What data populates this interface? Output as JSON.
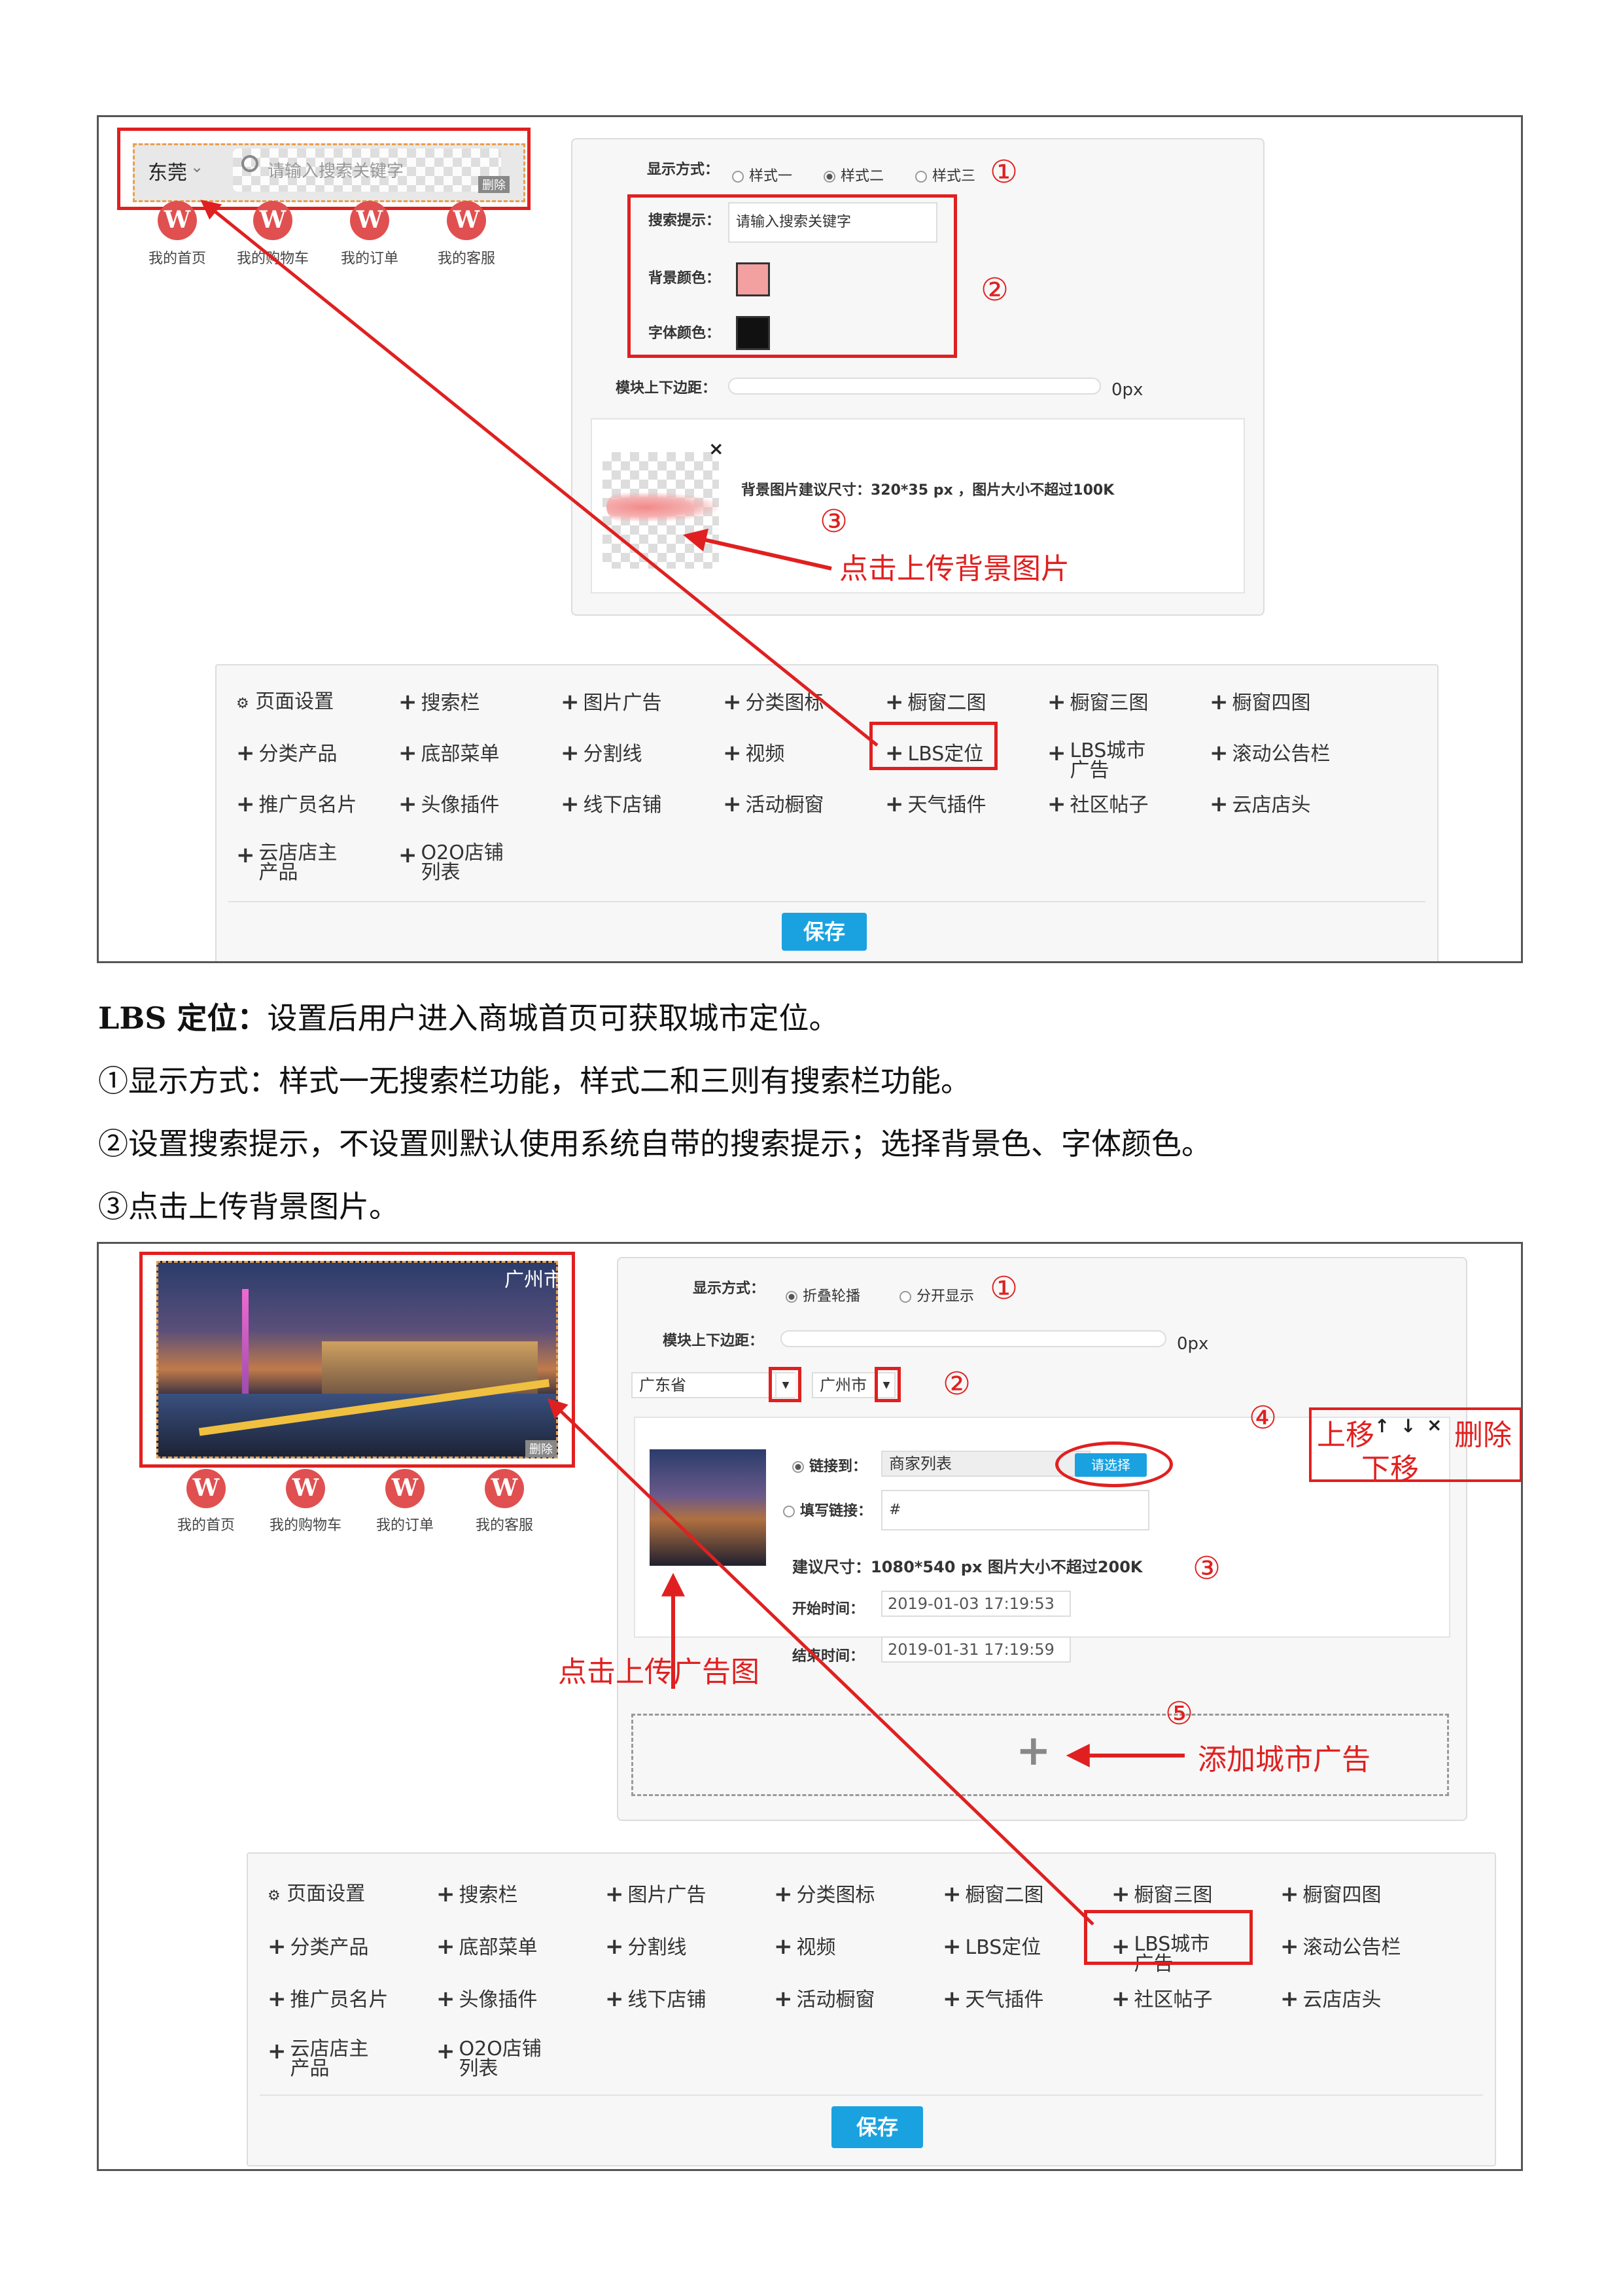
{
  "shot1": {
    "nav": {
      "city": "东莞",
      "search_placeholder": "请输入搜索关键字",
      "delete_label": "删除",
      "items": [
        "我的首页",
        "我的购物车",
        "我的订单",
        "我的客服"
      ]
    },
    "settings": {
      "display_label": "显示方式：",
      "styles": [
        "样式一",
        "样式二",
        "样式三"
      ],
      "search_hint_label": "搜索提示：",
      "search_hint_value": "请输入搜索关键字",
      "bg_color_label": "背景颜色：",
      "font_color_label": "字体颜色：",
      "margin_label": "模块上下边距：",
      "margin_value": "0px",
      "bg_image_hint": "背景图片建议尺寸：320*35 px ，图片大小不超过100K",
      "remove_glyph": "×"
    },
    "annotations": {
      "n1": "①",
      "n2": "②",
      "n3": "③",
      "upload_bg": "点击上传背景图片"
    }
  },
  "component_grid": {
    "page_settings": "页面设置",
    "items": [
      "搜索栏",
      "图片广告",
      "分类图标",
      "橱窗二图",
      "橱窗三图",
      "橱窗四图",
      "分类产品",
      "底部菜单",
      "分割线",
      "视频",
      "LBS定位",
      "LBS城市广告",
      "滚动公告栏",
      "推广员名片",
      "头像插件",
      "线下店铺",
      "活动橱窗",
      "天气插件",
      "社区帖子",
      "云店店头",
      "云店店主产品",
      "O2O店铺列表"
    ],
    "save": "保存"
  },
  "text": {
    "p1_title": "LBS 定位：",
    "p1_body": "设置后用户进入商城首页可获取城市定位。",
    "p2": "①显示方式：样式一无搜索栏功能，样式二和三则有搜索栏功能。",
    "p3": "②设置搜索提示，不设置则默认使用系统自带的搜索提示；选择背景色、字体颜色。",
    "p4": "③点击上传背景图片。"
  },
  "shot2": {
    "banner_city": "广州市",
    "delete_label": "删除",
    "nav_items": [
      "我的首页",
      "我的购物车",
      "我的订单",
      "我的客服"
    ],
    "settings": {
      "display_label": "显示方式：",
      "modes": [
        "折叠轮播",
        "分开显示"
      ],
      "margin_label": "模块上下边距：",
      "margin_value": "0px",
      "province": "广东省",
      "city": "广州市",
      "link_to_label": "链接到：",
      "link_to_value": "商家列表",
      "choose_button": "请选择",
      "fill_link_label": "填写链接：",
      "fill_link_value": "#",
      "size_hint": "建议尺寸：1080*540 px 图片大小不超过200K",
      "start_label": "开始时间：",
      "start_value": "2019-01-03 17:19:53",
      "end_label": "结束时间：",
      "end_value": "2019-01-31 17:19:59",
      "add_glyph": "+"
    },
    "annotations": {
      "n1": "①",
      "n2": "②",
      "n3": "③",
      "n4": "④",
      "n5": "⑤",
      "move_up": "上移",
      "move_down": "下移",
      "delete": "删除",
      "upload_ad": "点击上传广告图",
      "add_city_ad": "添加城市广告"
    }
  }
}
